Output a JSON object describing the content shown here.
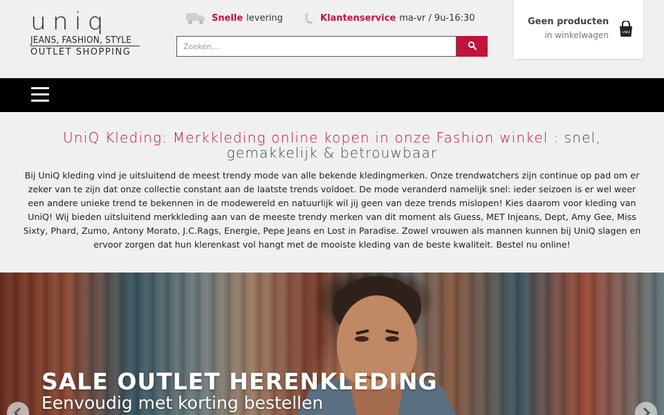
{
  "brand": {
    "name": "uniq",
    "tagline_1": "JEANS, FASHION, STYLE",
    "tagline_2": "OUTLET SHOPPING",
    "accent_color": "#c0143c"
  },
  "usps": [
    {
      "icon": "truck-icon",
      "highlight": "Snelle",
      "text": "levering"
    },
    {
      "icon": "phone-icon",
      "highlight": "Klantenservice",
      "text": "ma-vr / 9u-16:30"
    }
  ],
  "search": {
    "placeholder": "Zoeken...",
    "value": "",
    "button_icon": "search-icon"
  },
  "cart": {
    "title": "Geen producten",
    "subtitle": "in winkelwagen",
    "icon": "shopping-bag-icon",
    "bag_label": "UNIQ"
  },
  "nav": {
    "menu_icon": "hamburger-menu-icon"
  },
  "intro": {
    "title_accent": "UniQ Kleding: Merkkleding online kopen in onze Fashion winkel",
    "title_rest": " : snel, gemakkelijk & betrouwbaar",
    "text": "Bij UniQ kleding vind je uitsluitend de meest trendy mode van alle bekende kledingmerken. Onze trendwatchers zijn continue op pad om er zeker van te zijn dat onze collectie constant aan de laatste trends voldoet. De mode veranderd namelijk snel: ieder seizoen is er wel weer een andere unieke trend te bekennen in de modewereld en natuurlijk wil jij geen van deze trends mislopen! Kies daarom voor kleding van UniQ! Wij bieden uitsluitend merkkleding aan van de meeste trendy merken van dit moment als Guess, MET Injeans, Dept, Amy Gee, Miss Sixty, Phard, Zumo, Antony Morato, J.C.Rags, Energie, Pepe Jeans en Lost in Paradise. Zowel vrouwen als mannen kunnen bij UniQ slagen en ervoor zorgen dat hun klerenkast vol hangt met de mooiste kleding van de beste kwaliteit. Bestel nu online!"
  },
  "banner": {
    "title": "SALE OUTLET HERENKLEDING",
    "subtitle": "Eenvoudig met korting bestellen",
    "prev_icon": "chevron-left-icon",
    "next_icon": "chevron-right-icon"
  }
}
